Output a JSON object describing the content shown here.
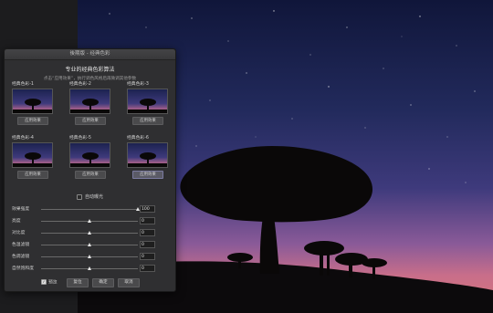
{
  "dialog": {
    "title": "後期版 - 经典色彩",
    "heading": "专业的经典色彩算法",
    "subheading": "点击“应用效果”，执行调色风格后再微调其他参数"
  },
  "presets": [
    {
      "label": "经典色彩-1",
      "button": "应用效果",
      "selected": false
    },
    {
      "label": "经典色彩-2",
      "button": "应用效果",
      "selected": false
    },
    {
      "label": "经典色彩-3",
      "button": "应用效果",
      "selected": false
    },
    {
      "label": "经典色彩-4",
      "button": "应用效果",
      "selected": false
    },
    {
      "label": "经典色彩-5",
      "button": "应用效果",
      "selected": false
    },
    {
      "label": "经典色彩-6",
      "button": "应用效果",
      "selected": true
    }
  ],
  "auto_exposure": {
    "label": "自动曝光",
    "checked": false
  },
  "sliders": [
    {
      "label": "效果强度",
      "value": "100",
      "level": 1.0
    },
    {
      "label": "亮度",
      "value": "0",
      "level": 0.5
    },
    {
      "label": "对比度",
      "value": "0",
      "level": 0.5
    },
    {
      "label": "色温滤镜",
      "value": "0",
      "level": 0.5
    },
    {
      "label": "色调滤镜",
      "value": "0",
      "level": 0.5
    },
    {
      "label": "自然饱和度",
      "value": "0",
      "level": 0.5
    }
  ],
  "footer": {
    "preview_label": "预览",
    "preview_checked": true,
    "reset_label": "复位",
    "ok_label": "确定",
    "cancel_label": "取消"
  },
  "colors": {
    "sky_top": "#12183a",
    "sky_mid": "#3c3a78",
    "sky_horizon": "#c46a8c",
    "silhouette": "#0a0808"
  }
}
